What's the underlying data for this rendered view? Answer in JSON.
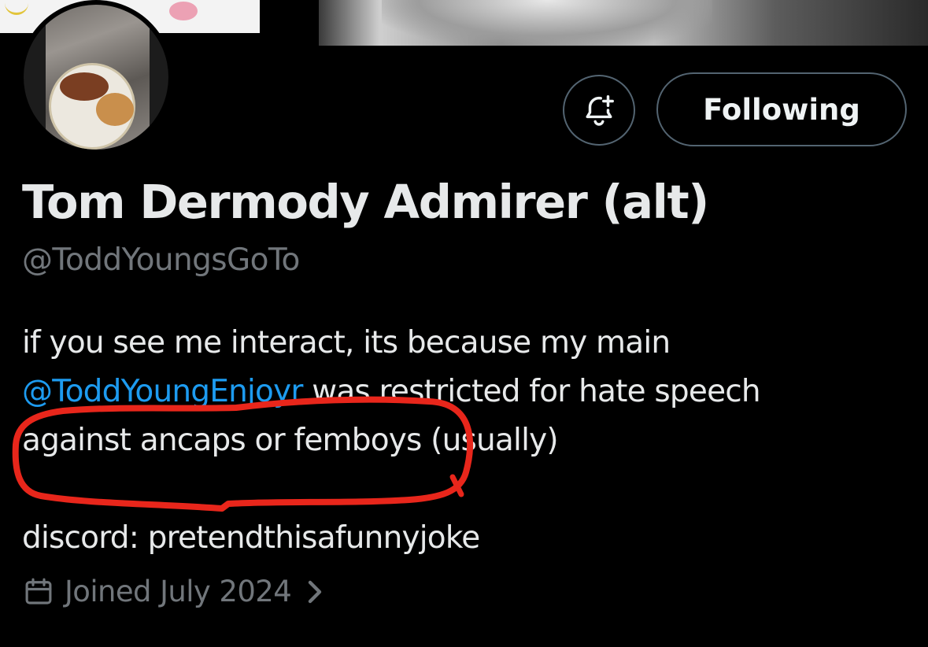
{
  "profile": {
    "display_name": "Tom Dermody Admirer (alt)",
    "handle": "@ToddYoungsGoTo",
    "bio": {
      "line1": "if you see me interact, its because my main",
      "mention": "@ToddYoungEnjoyr",
      "line2_rest": " was restricted for hate speech",
      "line3": "against ancaps or femboys (usually)",
      "line4": "discord: pretendthisafunnyjoke"
    },
    "joined": "Joined July 2024"
  },
  "actions": {
    "notify_icon": "bell-plus-icon",
    "follow_label": "Following"
  },
  "icons": {
    "joined_icon": "calendar-icon",
    "joined_chevron": "chevron-right-icon"
  },
  "colors": {
    "background": "#000000",
    "text": "#e7e9ea",
    "muted": "#71767b",
    "mention": "#1d9bf0",
    "button_border": "#536471",
    "annotation": "#e8261b"
  }
}
